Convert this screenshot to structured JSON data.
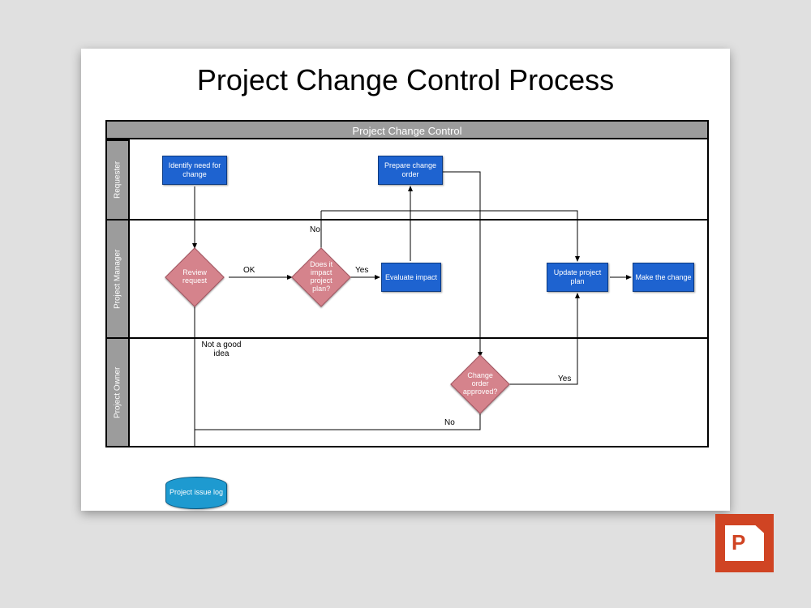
{
  "title": "Project Change Control Process",
  "header": "Project Change Control",
  "lanes": {
    "requester": "Requester",
    "pm": "Project Manager",
    "owner": "Project Owner"
  },
  "nodes": {
    "identify": "Identify need for change",
    "prepare": "Prepare change order",
    "review": "Review request",
    "impact_q": "Does it impact project plan?",
    "evaluate": "Evaluate impact",
    "update": "Update project plan",
    "make": "Make the change",
    "approved_q": "Change order approved?",
    "log": "Project issue log"
  },
  "edges": {
    "ok": "OK",
    "no": "No",
    "yes": "Yes",
    "not_good": "Not a good idea",
    "yes2": "Yes",
    "no2": "No"
  },
  "app_icon": "powerpoint-icon"
}
